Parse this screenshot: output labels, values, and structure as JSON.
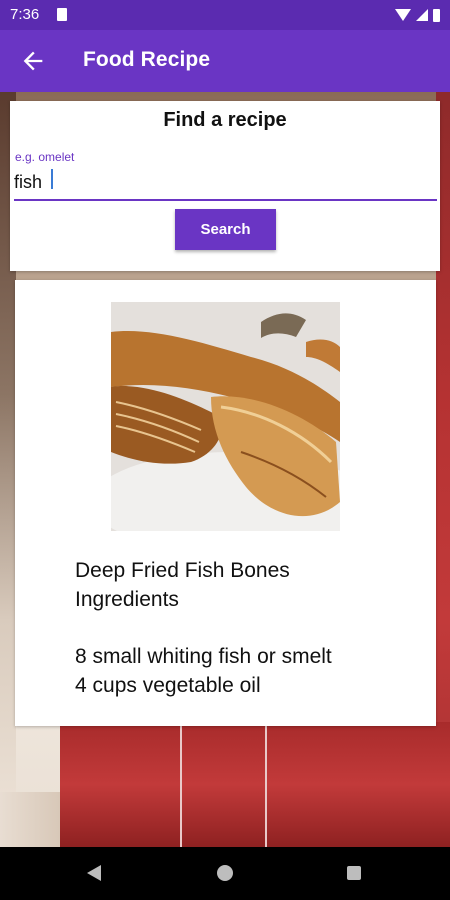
{
  "status_bar": {
    "time": "7:36"
  },
  "app_bar": {
    "title": "Food Recipe",
    "back_icon": "arrow-left-icon"
  },
  "search": {
    "heading": "Find a recipe",
    "label": "e.g. omelet",
    "value": "fish",
    "button_label": "Search"
  },
  "recipe": {
    "title": "Deep Fried Fish Bones",
    "subtitle": "Ingredients",
    "ingredients": [
      "8 small whiting fish or smelt",
      "4 cups vegetable oil"
    ]
  },
  "colors": {
    "primary": "#6a35c4",
    "status_bar": "#5b2bb0"
  }
}
